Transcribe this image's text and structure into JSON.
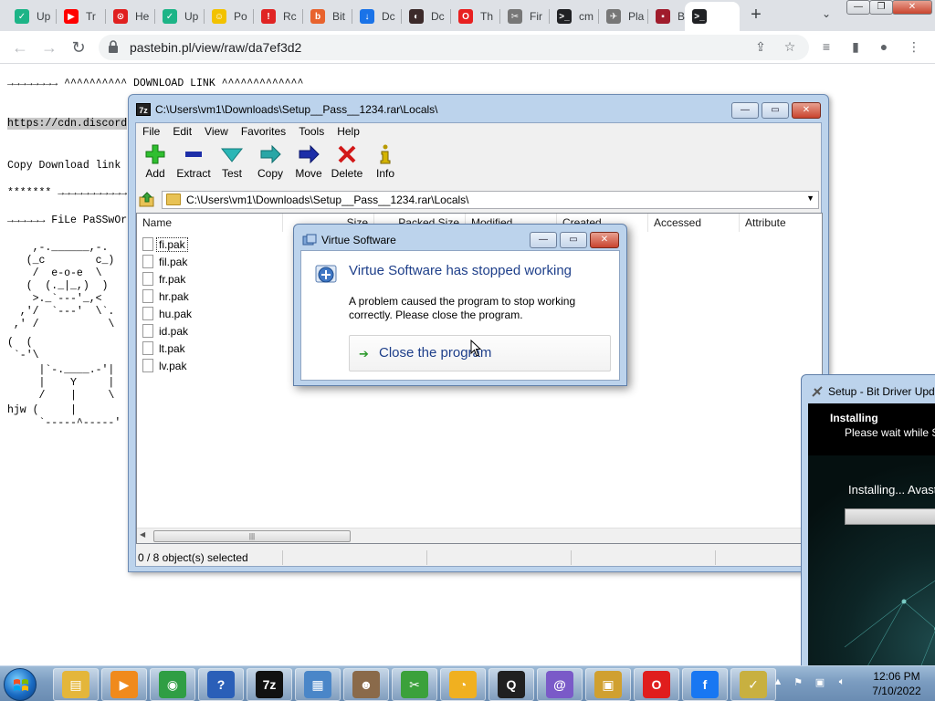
{
  "browser": {
    "tabs": [
      {
        "title": "Up",
        "color": "#1db487",
        "glyph": "✓"
      },
      {
        "title": "Tr",
        "color": "#ff0000",
        "glyph": "▶"
      },
      {
        "title": "He",
        "color": "#e02020",
        "glyph": "⊙"
      },
      {
        "title": "Up",
        "color": "#1db487",
        "glyph": "✓"
      },
      {
        "title": "Po",
        "color": "#f2c200",
        "glyph": "☺"
      },
      {
        "title": "Rc",
        "color": "#e02424",
        "glyph": "!"
      },
      {
        "title": "Bit",
        "color": "#e8632e",
        "glyph": "b"
      },
      {
        "title": "Dc",
        "color": "#1a73e8",
        "glyph": "↓"
      },
      {
        "title": "Dc",
        "color": "#3c2a2a",
        "glyph": "◐"
      },
      {
        "title": "Th",
        "color": "#e82020",
        "glyph": "O"
      },
      {
        "title": "Fir",
        "color": "#777777",
        "glyph": "✂"
      },
      {
        "title": "cm",
        "color": "#202124",
        "glyph": ">_"
      },
      {
        "title": "Pla",
        "color": "#777777",
        "glyph": "✈"
      },
      {
        "title": "Ba",
        "color": "#a01c2c",
        "glyph": "▪"
      },
      {
        "title": "",
        "color": "#202124",
        "glyph": ">_"
      }
    ],
    "tab_close": "✕",
    "new_tab": "+",
    "tab_search": "⌄",
    "url": "pastebin.pl/view/raw/da7ef3d2",
    "window_min": "—",
    "window_restore": "❐",
    "window_close": "✕"
  },
  "page": {
    "lines": [
      "→→→→→→→→ ^^^^^^^^^^ DOWNLOAD LINK ^^^^^^^^^^^^^",
      "https://cdn.discord",
      "Copy Download link",
      "******* →→→→→→→→→→→",
      "→→→→→→ FiLe PaSSwOr",
      "    ,-.______,-.",
      "   (_c        c_)",
      "    /  e-o-e  \\",
      "   (  (._|_,)  )",
      "    >._`---'_,<",
      "  ,'/  `---'  \\`.",
      " ,' /           \\",
      "(  (",
      " `-'\\",
      "     |`-.____.-'|",
      "     |    Y     |",
      "     /    |     \\",
      "hjw (     |",
      "     `-----^-----'"
    ]
  },
  "sevenzip": {
    "title": "C:\\Users\\vm1\\Downloads\\Setup__Pass__1234.rar\\Locals\\",
    "icon_label": "7z",
    "menu": [
      "File",
      "Edit",
      "View",
      "Favorites",
      "Tools",
      "Help"
    ],
    "toolbar": [
      {
        "label": "Add",
        "icon": "plus-icon"
      },
      {
        "label": "Extract",
        "icon": "minus-icon"
      },
      {
        "label": "Test",
        "icon": "check-icon"
      },
      {
        "label": "Copy",
        "icon": "copy-arrow-icon"
      },
      {
        "label": "Move",
        "icon": "move-arrow-icon"
      },
      {
        "label": "Delete",
        "icon": "delete-x-icon"
      },
      {
        "label": "Info",
        "icon": "info-icon"
      }
    ],
    "address": "C:\\Users\\vm1\\Downloads\\Setup__Pass__1234.rar\\Locals\\",
    "columns": [
      "Name",
      "Size",
      "Packed Size",
      "Modified",
      "Created",
      "Accessed",
      "Attribute"
    ],
    "files": [
      "fi.pak",
      "fil.pak",
      "fr.pak",
      "hr.pak",
      "hu.pak",
      "id.pak",
      "lt.pak",
      "lv.pak"
    ],
    "status": "0 / 8 object(s) selected",
    "scroll_grip": "|||"
  },
  "dialog": {
    "title": "Virtue Software",
    "heading": "Virtue Software has stopped working",
    "message": "A problem caused the program to stop working correctly. Please close the program.",
    "action": "Close the program"
  },
  "setup": {
    "title": "Setup - Bit Driver Updater",
    "banner_title": "Installing",
    "banner_sub": "Please wait while Setup installs",
    "installing": "Installing... Avast"
  },
  "taskbar": {
    "apps": [
      {
        "name": "explorer",
        "color": "#e4b63a",
        "glyph": "▤"
      },
      {
        "name": "media",
        "color": "#f08a1c",
        "glyph": "▶"
      },
      {
        "name": "chrome",
        "color": "#2f9e44",
        "glyph": "◉"
      },
      {
        "name": "help",
        "color": "#2a5fb8",
        "glyph": "?"
      },
      {
        "name": "7zip",
        "color": "#111111",
        "glyph": "7z"
      },
      {
        "name": "control",
        "color": "#4a86c8",
        "glyph": "▦"
      },
      {
        "name": "users",
        "color": "#8a6a4a",
        "glyph": "☻"
      },
      {
        "name": "tools",
        "color": "#3ba13b",
        "glyph": "✂"
      },
      {
        "name": "bitwarden",
        "color": "#f0b020",
        "glyph": "◔"
      },
      {
        "name": "q",
        "color": "#202020",
        "glyph": "Q"
      },
      {
        "name": "mail",
        "color": "#7a5ac8",
        "glyph": "@"
      },
      {
        "name": "archive",
        "color": "#d0a030",
        "glyph": "▣"
      },
      {
        "name": "opera",
        "color": "#e01d1d",
        "glyph": "O"
      },
      {
        "name": "facebook",
        "color": "#1877f2",
        "glyph": "f"
      },
      {
        "name": "setup",
        "color": "#c8b040",
        "glyph": "✓"
      }
    ],
    "time": "12:06 PM",
    "date": "7/10/2022"
  }
}
